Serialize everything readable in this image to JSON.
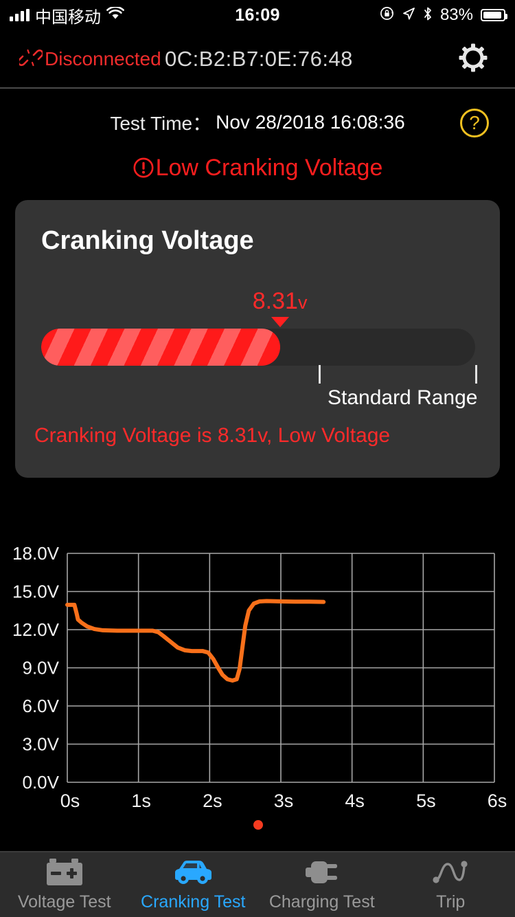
{
  "status_bar": {
    "carrier": "中国移动",
    "time": "16:09",
    "battery_percent": "83%",
    "icons": [
      "signal-bars-icon",
      "wifi-icon",
      "rotation-lock-icon",
      "location-arrow-icon",
      "bluetooth-icon",
      "battery-icon"
    ]
  },
  "app_bar": {
    "connection_status": "Disconnected",
    "device_mac": "0C:B2:B7:0E:76:48",
    "settings_icon": "gear-icon",
    "status_icon": "broken-link-icon",
    "status_color": "#ef2c2c"
  },
  "test_info": {
    "label": "Test Time：",
    "value": "Nov 28/2018 16:08:36",
    "help_label": "?",
    "help_color": "#f0c020"
  },
  "warning": {
    "icon": "exclamation-circle-icon",
    "text": "Low Cranking Voltage",
    "color": "#ff1e1e"
  },
  "card": {
    "title": "Cranking Voltage",
    "measured_value": "8.31",
    "measured_unit": "v",
    "marker_percent": 55,
    "fill_percent": 55,
    "range_label": "Standard Range",
    "range_start_percent": 64,
    "range_end_percent": 106,
    "note": "Cranking Voltage is 8.31v, Low Voltage",
    "note_color": "#ff2a2a",
    "bar_color": "#ff1a1a",
    "bar_stripe_color": "#ff5e5e",
    "background": "#343434"
  },
  "chart_data": {
    "type": "line",
    "title": "",
    "xlabel": "",
    "ylabel": "",
    "xlim": [
      0,
      6
    ],
    "ylim": [
      0,
      18
    ],
    "x_tick_labels": [
      "0s",
      "1s",
      "2s",
      "3s",
      "4s",
      "5s",
      "6s"
    ],
    "x_ticks": [
      0,
      1,
      2,
      3,
      4,
      5,
      6
    ],
    "y_tick_labels": [
      "0.0V",
      "3.0V",
      "6.0V",
      "9.0V",
      "12.0V",
      "15.0V",
      "18.0V"
    ],
    "y_ticks": [
      0,
      3,
      6,
      9,
      12,
      15,
      18
    ],
    "grid": true,
    "legend": "none",
    "line_color": "#f9701a",
    "series": [
      {
        "name": "Cranking Voltage",
        "x": [
          0.0,
          0.05,
          0.1,
          0.13,
          0.15,
          0.2,
          0.28,
          0.38,
          0.5,
          0.7,
          1.0,
          1.2,
          1.28,
          1.35,
          1.45,
          1.55,
          1.65,
          1.75,
          1.9,
          1.98,
          2.05,
          2.12,
          2.18,
          2.25,
          2.32,
          2.38,
          2.42,
          2.46,
          2.5,
          2.55,
          2.62,
          2.7,
          2.8,
          3.0,
          3.2,
          3.4,
          3.6
        ],
        "y": [
          13.95,
          13.95,
          13.95,
          13.3,
          12.8,
          12.55,
          12.25,
          12.05,
          11.95,
          11.92,
          11.92,
          11.92,
          11.8,
          11.5,
          11.05,
          10.6,
          10.38,
          10.32,
          10.32,
          10.2,
          9.7,
          9.0,
          8.45,
          8.1,
          8.0,
          8.1,
          8.9,
          10.6,
          12.3,
          13.5,
          14.05,
          14.22,
          14.25,
          14.22,
          14.2,
          14.2,
          14.18
        ],
        "min": 8.0,
        "max": 14.25,
        "end_time": 3.6
      }
    ]
  },
  "page_indicator": {
    "dots": 1,
    "active_index": 0,
    "color": "#f53b20"
  },
  "tabs": [
    {
      "label": "Voltage Test",
      "icon": "battery-icon",
      "active": false
    },
    {
      "label": "Cranking Test",
      "icon": "car-icon",
      "active": true
    },
    {
      "label": "Charging Test",
      "icon": "plug-icon",
      "active": false
    },
    {
      "label": "Trip",
      "icon": "trip-line-icon",
      "active": false
    }
  ],
  "theme": {
    "active_tab_color": "#29a8ff",
    "inactive_tab_color": "#9a9a9a"
  }
}
